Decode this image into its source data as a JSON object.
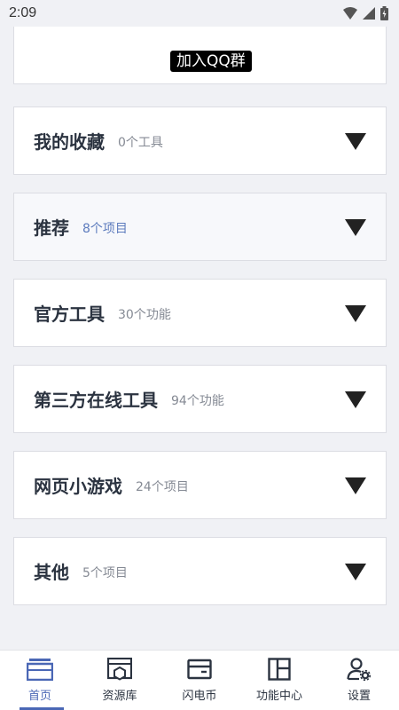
{
  "status": {
    "time": "2:09"
  },
  "top_card": {
    "badge": "加入QQ群"
  },
  "sections": [
    {
      "title": "我的收藏",
      "count": "0个工具"
    },
    {
      "title": "推荐",
      "count": "8个项目"
    },
    {
      "title": "官方工具",
      "count": "30个功能"
    },
    {
      "title": "第三方在线工具",
      "count": "94个功能"
    },
    {
      "title": "网页小游戏",
      "count": "24个项目"
    },
    {
      "title": "其他",
      "count": "5个项目"
    }
  ],
  "nav": [
    {
      "label": "首页",
      "icon": "home-icon",
      "active": true
    },
    {
      "label": "资源库",
      "icon": "resource-icon"
    },
    {
      "label": "闪电币",
      "icon": "wallet-icon"
    },
    {
      "label": "功能中心",
      "icon": "grid-icon"
    },
    {
      "label": "设置",
      "icon": "user-settings-icon"
    }
  ],
  "colors": {
    "accent": "#4a67b5",
    "background": "#f0f1f5"
  }
}
